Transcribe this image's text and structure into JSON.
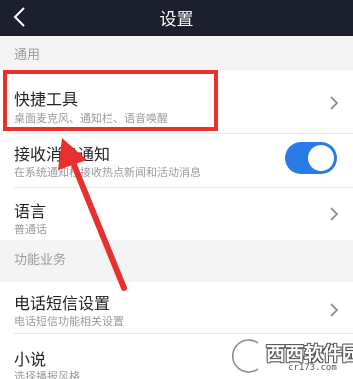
{
  "header": {
    "title": "设置"
  },
  "sections": {
    "general": "通用",
    "business": "功能业务"
  },
  "rows": {
    "shortcut": {
      "title": "快捷工具",
      "subtitle": "桌面麦克风、通知栏、语音唤醒"
    },
    "notify": {
      "title": "接收消息通知",
      "subtitle": "在系统通知栏接收热点新闻和活动消息",
      "enabled": true
    },
    "language": {
      "title": "语言",
      "subtitle": "普通话"
    },
    "sms": {
      "title": "电话短信设置",
      "subtitle": "电话短信功能相关设置"
    },
    "novel": {
      "title": "小说",
      "subtitle": "选择播报风格"
    }
  },
  "watermark": {
    "text": "西西软件园",
    "url": "cr173.com"
  },
  "colors": {
    "header_bg": "#1c1f2d",
    "accent": "#2a7ae8",
    "annotation": "#e8312f"
  }
}
